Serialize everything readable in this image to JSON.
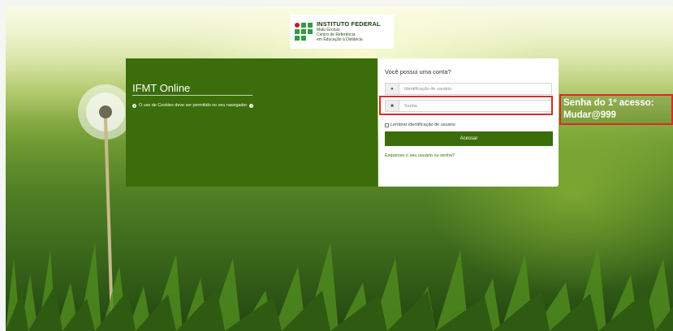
{
  "logo": {
    "title": "INSTITUTO FEDERAL",
    "line1": "Mato Grosso",
    "line2": "Centro de Referência",
    "line3": "em Educação à Distância",
    "brand_green": "#2f9e41",
    "brand_red": "#c8191e"
  },
  "left_panel": {
    "site_title": "IFMT Online",
    "cookie_notice": "O uso de Cookies deve ser permitido no seu navegador",
    "background": "#3b6d0b"
  },
  "login": {
    "heading": "Você possui uma conta?",
    "username_placeholder": "Identificação de usuário",
    "username_icon": "user-icon",
    "password_placeholder": "Senha",
    "password_icon": "lock-icon",
    "remember_label": "Lembrar identificação de usuário",
    "submit_label": "Acessar",
    "forgot_link": "Esqueceu o seu usuário ou senha?"
  },
  "annotation": {
    "line1": "Senha do 1º acesso:",
    "line2": "Mudar@999",
    "color": "#d62b2b"
  }
}
